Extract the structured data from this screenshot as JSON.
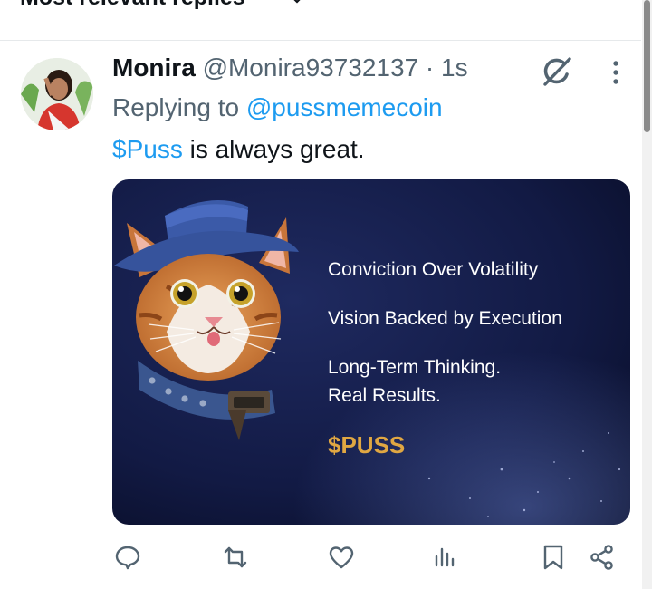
{
  "header": {
    "label": "Most relevant replies"
  },
  "post": {
    "author_name": "Monira",
    "author_handle": "@Monira93732137",
    "separator": " · ",
    "time": "1s",
    "replying_prefix": "Replying to ",
    "replying_to": "@pussmemecoin",
    "text_tag": "$Puss",
    "text_rest": " is always great."
  },
  "media": {
    "line1": "Conviction Over Volatility",
    "line2": "Vision Backed by Execution",
    "line3a": "Long-Term Thinking.",
    "line3b": "Real Results.",
    "ticker": "$PUSS",
    "ticker_color": "#e0a742",
    "bg_color": "#10163a"
  },
  "actions": [
    "reply-icon",
    "repost-icon",
    "like-icon",
    "views-icon",
    "bookmark-icon",
    "share-icon"
  ],
  "colors": {
    "link": "#1d9bf0",
    "muted": "#536471",
    "text": "#0f1419"
  }
}
